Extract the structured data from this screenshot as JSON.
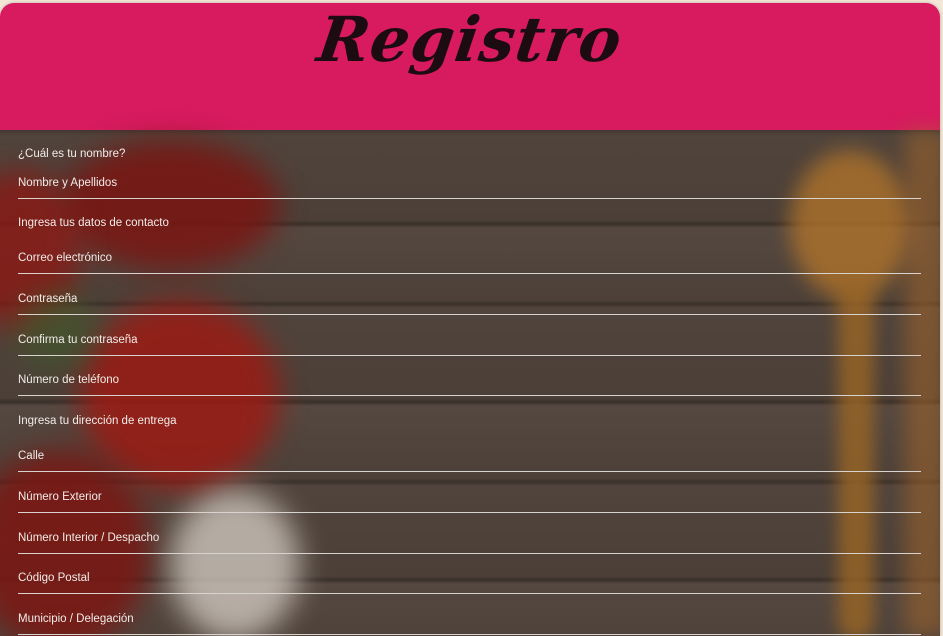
{
  "header": {
    "title": "Registro"
  },
  "colors": {
    "header_bg": "#d81b5f",
    "title_color": "#1c0c12",
    "field_line": "#d9d3cf"
  },
  "form": {
    "sections": [
      {
        "heading": "¿Cuál es tu nombre?",
        "fields": [
          {
            "placeholder": "Nombre y Apellidos"
          }
        ]
      },
      {
        "heading": "Ingresa tus datos de contacto",
        "fields": [
          {
            "placeholder": "Correo electrónico"
          },
          {
            "placeholder": "Contraseña"
          },
          {
            "placeholder": "Confirma tu contraseña"
          },
          {
            "placeholder": "Número de teléfono"
          }
        ]
      },
      {
        "heading": "Ingresa tu dirección de entrega",
        "fields": [
          {
            "placeholder": "Calle"
          },
          {
            "placeholder": "Número Exterior"
          },
          {
            "placeholder": "Número Interior / Despacho"
          },
          {
            "placeholder": "Código Postal"
          },
          {
            "placeholder": "Municipio / Delegación"
          }
        ]
      }
    ]
  }
}
